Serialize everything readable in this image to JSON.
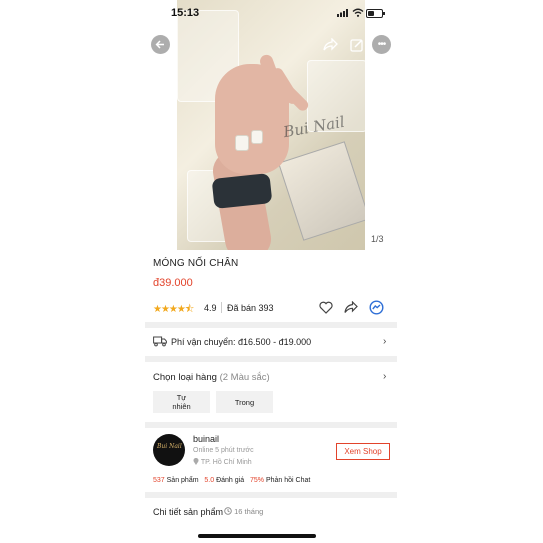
{
  "status_bar": {
    "time": "15:13"
  },
  "product": {
    "title": "MÓNG NỐI CHÂN",
    "price": "đ39.000",
    "image_counter": "1/3",
    "watermark": "Bui Nail",
    "rating": "4.9",
    "stars": "★★★★⯪",
    "sold": "Đã bán 393"
  },
  "shipping": {
    "label": "Phí vận chuyển: đ16.500 - đ19.000"
  },
  "variants": {
    "label": "Chọn loại hàng",
    "count": "(2 Màu sắc)",
    "options": [
      "Tự nhiên",
      "Trong"
    ]
  },
  "shop": {
    "name": "buinail",
    "online": "Online 5 phút trước",
    "location": "TP. Hồ Chí Minh",
    "view_button": "Xem Shop",
    "logo_text": "Bui Nail",
    "stats": {
      "products_num": "537",
      "products_label": "Sản phẩm",
      "reviews_num": "5.0",
      "reviews_label": "Đánh giá",
      "chat_num": "75%",
      "chat_label": "Phản hồi Chat"
    }
  },
  "details": {
    "label": "Chi tiết sản phẩm",
    "time": "16 tháng"
  },
  "icons": {
    "back": "arrow-left-icon",
    "share": "share-icon",
    "edit": "edit-icon",
    "more": "more-icon",
    "like": "heart-icon",
    "share_action": "share-icon",
    "chat": "messenger-icon",
    "truck": "truck-icon",
    "clock": "clock-icon"
  },
  "colors": {
    "accent": "#e2432b",
    "stars": "#f2a81d"
  }
}
